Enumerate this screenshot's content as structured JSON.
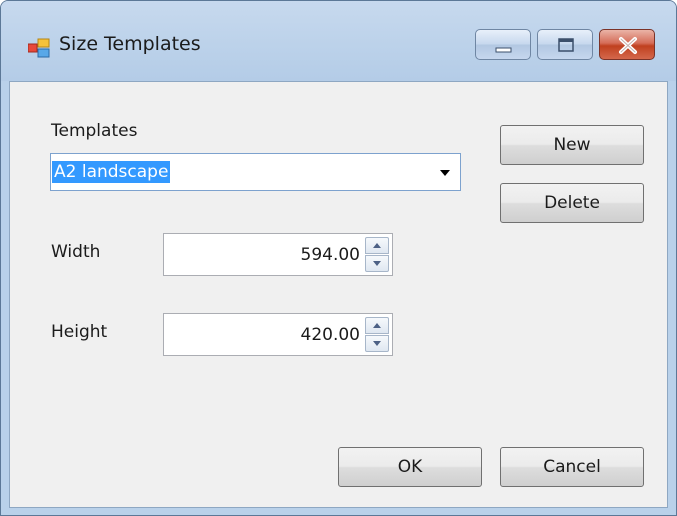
{
  "window": {
    "title": "Size Templates"
  },
  "form": {
    "templates_label": "Templates",
    "templates_selected": "A2 landscape",
    "width_label": "Width",
    "width_value": "594.00",
    "height_label": "Height",
    "height_value": "420.00"
  },
  "buttons": {
    "new_label": "New",
    "delete_label": "Delete",
    "ok_label": "OK",
    "cancel_label": "Cancel"
  },
  "colors": {
    "selection_highlight": "#3399ff",
    "titlebar": "#bcd2ea",
    "close_button": "#c7462b",
    "client_background": "#f0f0f0"
  },
  "icons": {
    "app": "application-window-icon",
    "minimize": "minimize-icon",
    "maximize": "maximize-icon",
    "close": "close-icon",
    "dropdown": "chevron-down-icon",
    "spin_up": "spin-up-arrow-icon",
    "spin_down": "spin-down-arrow-icon"
  }
}
